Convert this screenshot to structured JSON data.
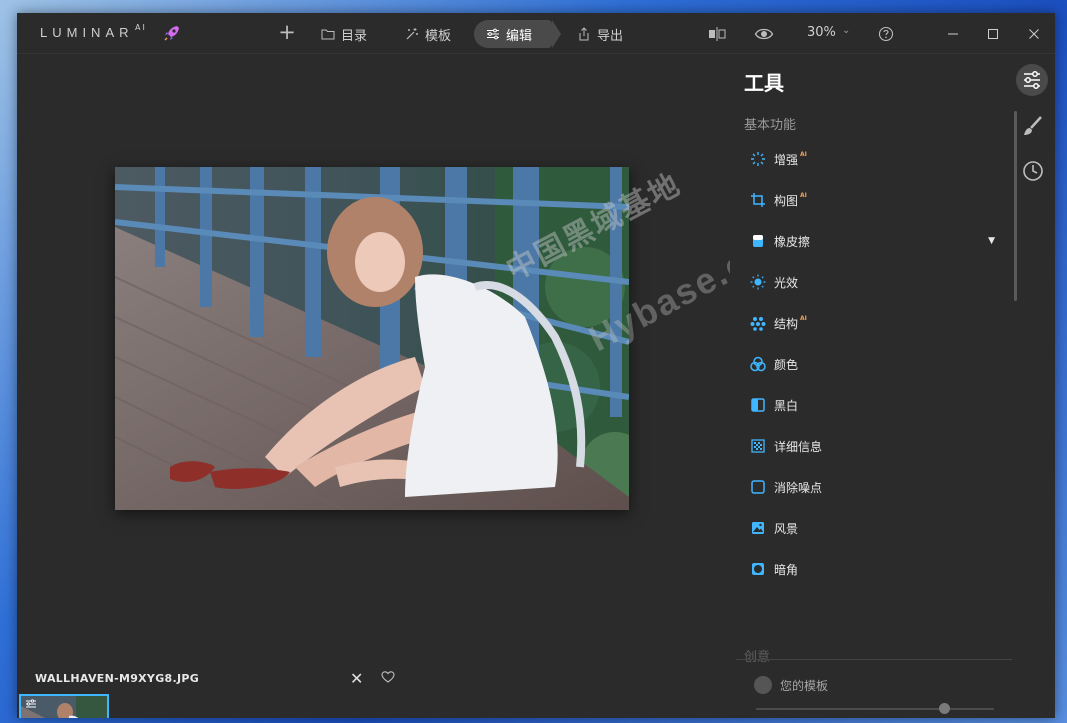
{
  "app": {
    "logo": "LUMINAR",
    "logo_sup": "AI",
    "icons": {
      "rocket": "rocket-icon"
    }
  },
  "nav": {
    "add_label": "+",
    "catalog": "目录",
    "templates": "模板",
    "edit": "编辑",
    "export": "导出"
  },
  "toolbar": {
    "zoom": "30%",
    "zoom_chevron": "⌄"
  },
  "window_controls": {
    "minimize": "minimize-icon",
    "maximize": "maximize-icon",
    "close": "close-icon"
  },
  "canvas": {
    "filename": "WALLHAVEN-M9XYG8.JPG",
    "close_symbol": "✕",
    "watermark_cn": "中国黑域基地",
    "watermark_en": "Hybase.com"
  },
  "thumbnail": {
    "close_symbol": "✕"
  },
  "panel": {
    "title": "工具",
    "section_basic": "基本功能",
    "tools": [
      {
        "label": "增强",
        "ai": "AI",
        "icon": "enhance-icon"
      },
      {
        "label": "构图",
        "ai": "AI",
        "icon": "crop-icon"
      },
      {
        "label": "橡皮擦",
        "ai": "",
        "icon": "eraser-icon",
        "dropdown": "▼"
      },
      {
        "label": "光效",
        "ai": "",
        "icon": "light-icon"
      },
      {
        "label": "结构",
        "ai": "AI",
        "icon": "structure-icon"
      },
      {
        "label": "颜色",
        "ai": "",
        "icon": "color-icon"
      },
      {
        "label": "黑白",
        "ai": "",
        "icon": "bw-icon"
      },
      {
        "label": "详细信息",
        "ai": "",
        "icon": "details-icon"
      },
      {
        "label": "消除噪点",
        "ai": "",
        "icon": "denoise-icon"
      },
      {
        "label": "风景",
        "ai": "",
        "icon": "landscape-icon"
      },
      {
        "label": "暗角",
        "ai": "",
        "icon": "vignette-icon"
      }
    ],
    "section_creative": "创意",
    "my_templates": "您的模板",
    "template_slider_value": 0.79
  },
  "colors": {
    "accent": "#3fb6ff",
    "ai_badge": "#f0a05a",
    "panel_bg": "#2b2b2b",
    "active_tab_bg": "#4a4a4a"
  }
}
